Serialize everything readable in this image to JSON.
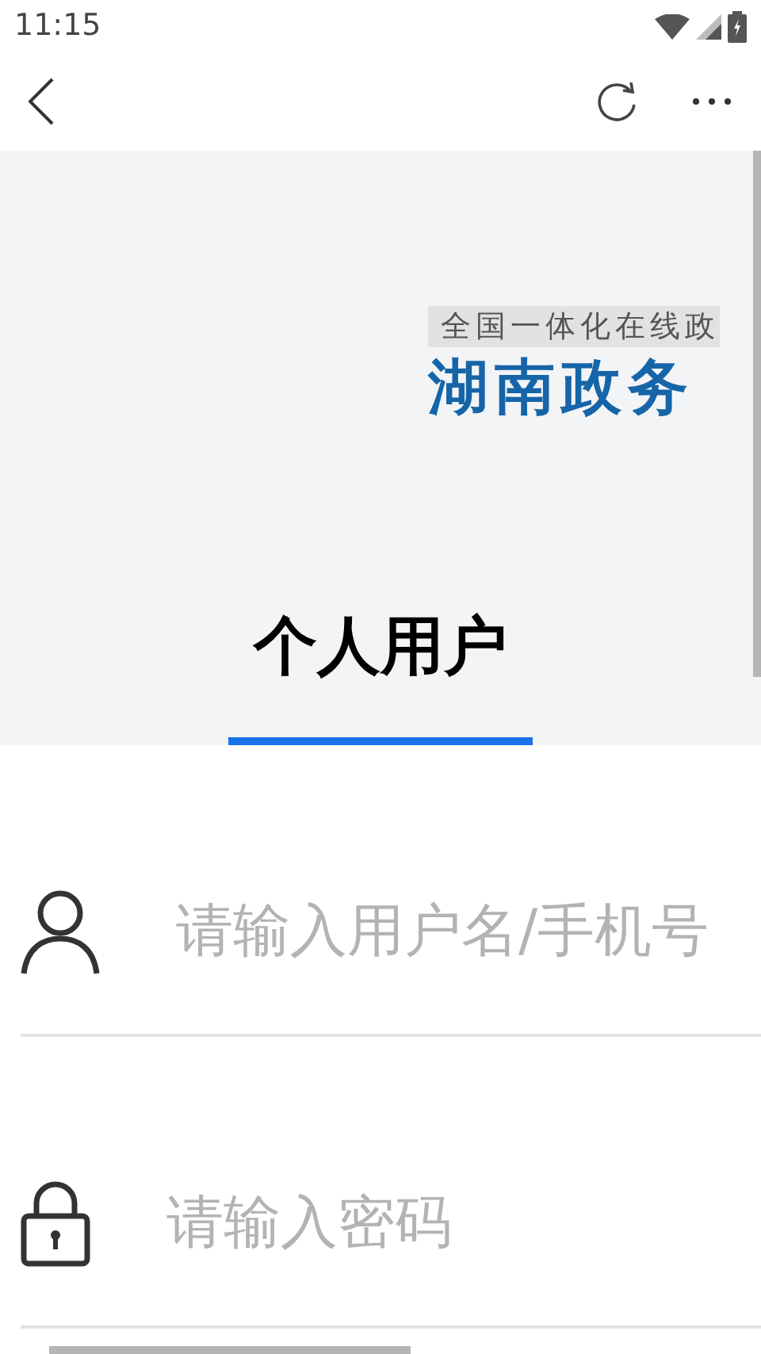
{
  "status_bar": {
    "time": "11:15"
  },
  "banner": {
    "logo_subtitle": "全国一体化在线政",
    "logo_title": "湖南政务"
  },
  "tabs": [
    {
      "label": "个人用户",
      "selected": true
    }
  ],
  "fields": [
    {
      "kind": "user",
      "placeholder": "请输入用户名/手机号"
    },
    {
      "kind": "lock",
      "placeholder": "请输入密码"
    }
  ]
}
